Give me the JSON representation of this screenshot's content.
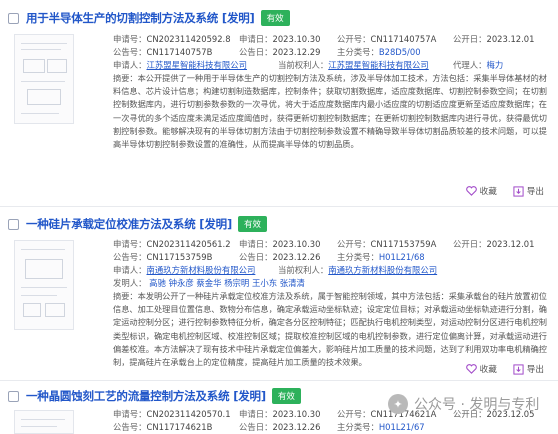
{
  "colors": {
    "title_blue": "#2257c9",
    "badge_green": "#2db15b",
    "text_gray": "#555555"
  },
  "icons": {
    "collect": "heart-icon",
    "export": "export-icon",
    "checkbox": "checkbox-icon"
  },
  "labels": {
    "app_no": "申请号：",
    "app_date": "申请日：",
    "pub_no": "公开号：",
    "pub_date": "公开日：",
    "ann_no": "公告号：",
    "ann_date": "公告日：",
    "ipc": "主分类号：",
    "applicant": "申请人：",
    "current_owner": "当前权利人：",
    "agent": "代理人：",
    "inventor": "发明人：",
    "abstract": "摘要："
  },
  "actions": {
    "collect": "收藏",
    "export": "导出"
  },
  "records": [
    {
      "title": "用于半导体生产的切割控制方法及系统 [发明]",
      "badge": "有效",
      "app_no": "CN2023114205​92.8",
      "app_date": "2023.10.30",
      "pub_no": "CN117140757A",
      "pub_date": "2023.12.01",
      "ann_no": "CN117140757B",
      "ann_date": "2023.12.29",
      "ipc": "B28D5/00",
      "applicant": "江苏盟星智能科技有限公司",
      "current_owner": "江苏盟星智能科技有限公司",
      "agent": "梅力",
      "abstract": "本公开提供了一种用于半导体生产的切割控制方法及系统，涉及半导体加工技术，方法包括：采集半导体基材的材料信息、芯片设计信息；构建切割制造数据库，控制条件；获取切割数据库，适应度数据库、切割控制参数空间；在切割控制数据库内，进行切割参数参数的一次寻优，将大于适应度数据库内最小适应度的切割适应度更新至适应度数据库；在一次寻优的多个适应度未满足适应度阈值时，获得更新切割控制数据库；在更新切割控制数据库内进行寻优，获得最优切割控制参数。能够解决现有的半导体切割方法由于切割控制参数设置不精确导致半导体切割品质较差的技术问题，可以提高半导体切割控制参数设置的准确性，从而提高半导体的切割品质。"
    },
    {
      "title": "一种硅片承载定位校准方法及系统 [发明]",
      "badge": "有效",
      "app_no": "CN202311420561.2",
      "app_date": "2023.10.30",
      "pub_no": "CN117153759A",
      "pub_date": "2023.12.01",
      "ann_no": "CN117153759B",
      "ann_date": "2023.12.26",
      "ipc": "H01L21/68",
      "applicant": "南通玖方新材料股份有限公司",
      "current_owner": "南通玖方新材料股份有限公司",
      "inventors": [
        "高驰",
        "钟永彦",
        "蔡金华",
        "杨宗明",
        "王小东",
        "张清清"
      ],
      "abstract": "本发明公开了一种硅片承载定位校准方法及系统，属于智能控制领域，其中方法包括：采集承载台的硅片放置初位信息、加工处理目位置信息、数物分布信息，确定承载运动坐标轨迹；设定定位目标；对承载运动坐标轨迹进行分割，确定运动控制分区；进行控制参数特征分析，确定各分区控制特征；匹配执行电机控制类型，对运动控制分区进行电机控制类型标识，确定电机控制区域、校准控制区域；提取校准控制区域的电机控制参数，进行定位偏离计算，对承载运动进行偏差校准。本方法解决了现有技术中硅片承载定位偏差大，影响硅片加工质量的技术问题，达到了利用双功率电机精确控制，提高硅片在承载台上的定位精度，提高硅片加工质量的技术效果。"
    },
    {
      "title": "一种晶圆蚀刻工艺的流量控制方法及系统 [发明]",
      "badge": "有效",
      "app_no": "CN202311420570.1",
      "app_date": "2023.10.30",
      "pub_no": "CN117174621A",
      "pub_date": "2023.12.05",
      "ann_no": "CN117174621B",
      "ann_date": "2023.12.26",
      "ipc": "H01L21/67"
    }
  ],
  "watermark": "公众号 · 发明与专利"
}
